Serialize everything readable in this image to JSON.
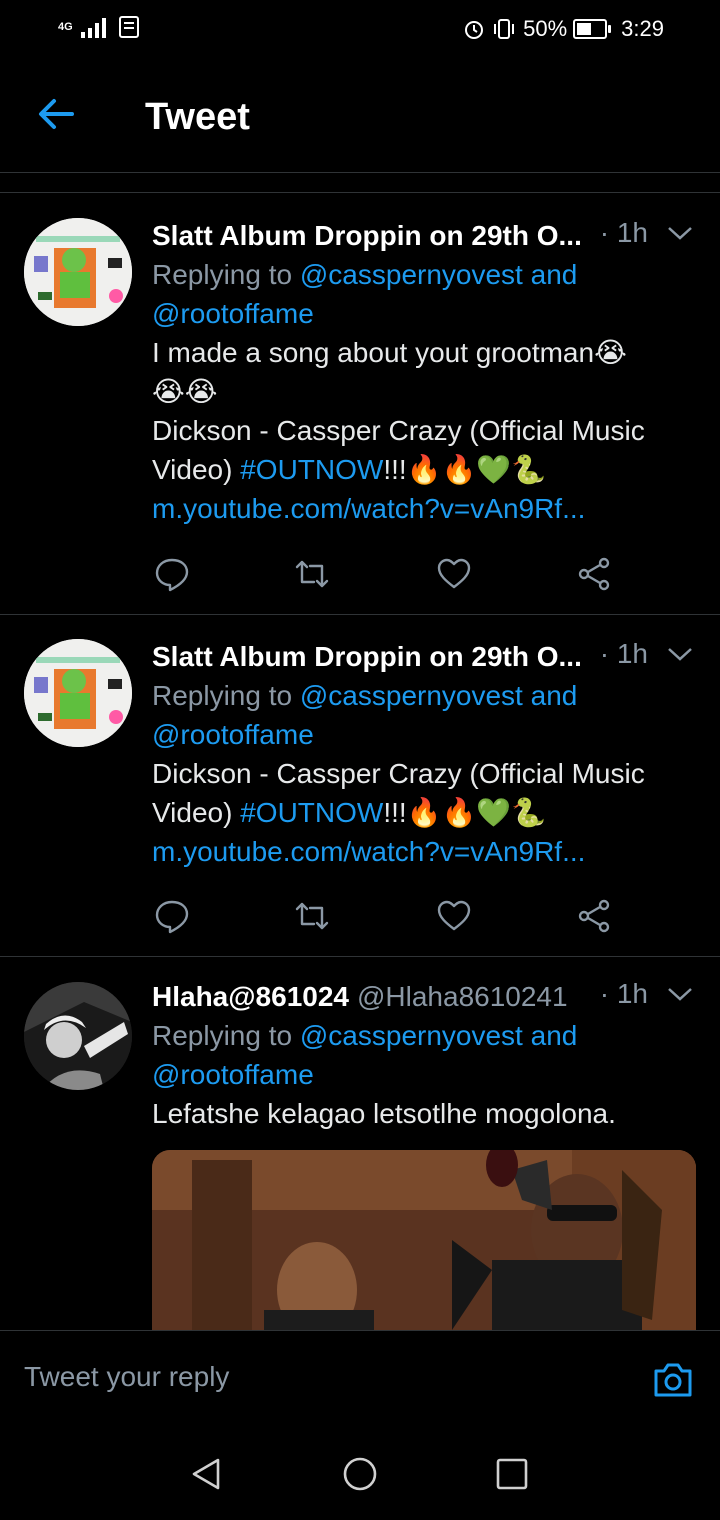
{
  "status": {
    "network": "4G",
    "battery": "50%",
    "time": "3:29"
  },
  "header": {
    "title": "Tweet"
  },
  "tweets": [
    {
      "name": "Slatt Album Droppin on 29th O...",
      "time": "· 1h",
      "replying_prefix": "Replying to ",
      "replying_user1": "@casspernyovest",
      "replying_and": " and",
      "replying_user2": "@rootoffame",
      "text_line1": "I made a song about yout grootman😭",
      "text_line2": "😭😭",
      "text_line3": "Dickson - Cassper Crazy (Official Music",
      "text_line4_prefix": "Video) ",
      "text_line4_tag": "#OUTNOW",
      "text_line4_suffix": "!!!🔥🔥💚🐍",
      "link": "m.youtube.com/watch?v=vAn9Rf..."
    },
    {
      "name": "Slatt Album Droppin on 29th O...",
      "time": "· 1h",
      "replying_prefix": "Replying to ",
      "replying_user1": "@casspernyovest",
      "replying_and": " and",
      "replying_user2": "@rootoffame",
      "text_line1": "Dickson - Cassper Crazy (Official Music",
      "text_line2_prefix": "Video) ",
      "text_line2_tag": "#OUTNOW",
      "text_line2_suffix": "!!!🔥🔥💚🐍",
      "link": "m.youtube.com/watch?v=vAn9Rf..."
    },
    {
      "name": "Hlaha@861024",
      "handle": "@Hlaha8610241",
      "time": "· 1h",
      "replying_prefix": "Replying to ",
      "replying_user1": "@casspernyovest",
      "replying_and": " and",
      "replying_user2": "@rootoffame",
      "text_line1": "Lefatshe kelagao letsotlhe mogolona."
    }
  ],
  "reply": {
    "placeholder": "Tweet your reply"
  },
  "icons": {
    "back": "arrow-left-icon",
    "reply": "reply-icon",
    "retweet": "retweet-icon",
    "like": "heart-icon",
    "share": "share-icon",
    "camera": "camera-icon"
  },
  "colors": {
    "accent": "#1d9bf0",
    "muted": "#8b98a5",
    "divider": "#2f3336"
  }
}
